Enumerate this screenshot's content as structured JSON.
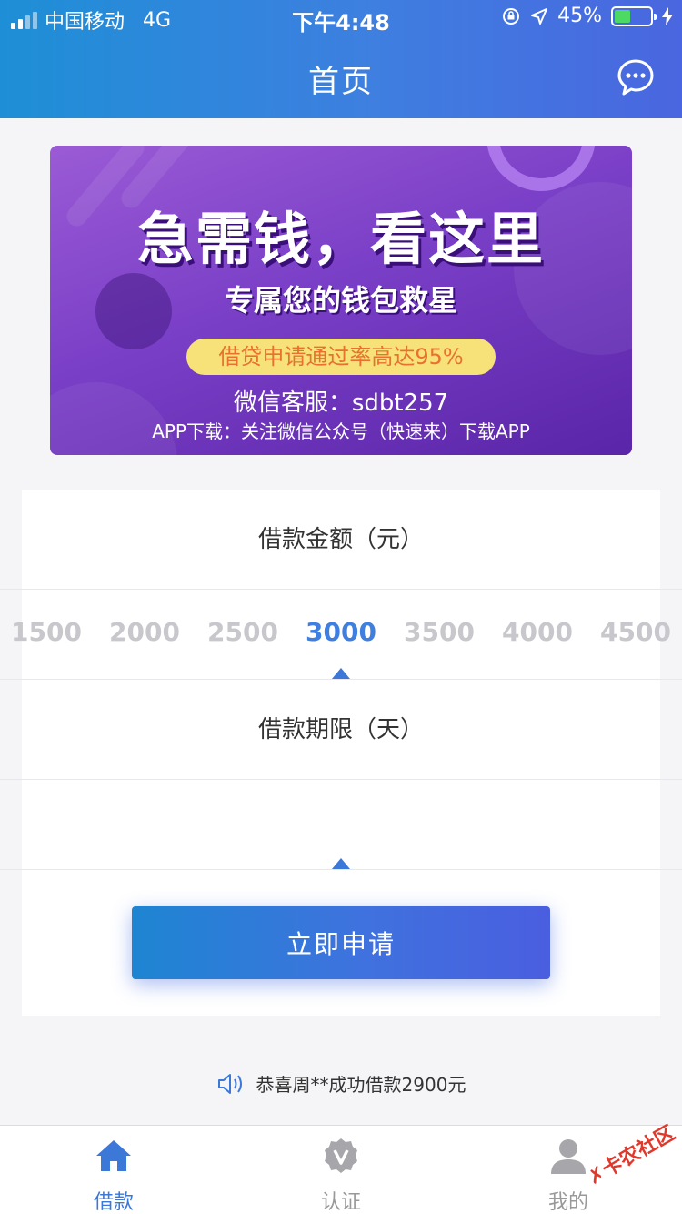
{
  "status_bar": {
    "carrier": "中国移动",
    "network": "4G",
    "time": "下午4:48",
    "battery_percent": "45%",
    "battery_level": 0.45
  },
  "nav": {
    "title": "首页",
    "message_icon": "chat-bubble-icon"
  },
  "banner": {
    "headline": "急需钱，看这里",
    "subtitle": "专属您的钱包救星",
    "pill": "借贷申请通过率高达95%",
    "wechat": "微信客服：sdbt257",
    "app_download": "APP下载：关注微信公众号（快速来）下载APP"
  },
  "loan": {
    "amount_title": "借款金额（元）",
    "amounts": [
      "1500",
      "2000",
      "2500",
      "3000",
      "3500",
      "4000",
      "4500"
    ],
    "selected_amount": "3000",
    "term_title": "借款期限（天）",
    "apply_label": "立即申请"
  },
  "notice": {
    "text": "恭喜周**成功借款2900元",
    "icon": "speaker-icon"
  },
  "tabbar": {
    "items": [
      {
        "label": "借款",
        "icon": "home-icon",
        "active": true
      },
      {
        "label": "认证",
        "icon": "verify-badge-icon",
        "active": false
      },
      {
        "label": "我的",
        "icon": "user-icon",
        "active": false
      }
    ]
  },
  "watermark": "卡农社区",
  "colors": {
    "accent": "#3b78d8",
    "header_start": "#1e8fd6",
    "header_end": "#4a66e0",
    "pill_bg": "#f7e27a",
    "pill_text": "#e9702e"
  }
}
